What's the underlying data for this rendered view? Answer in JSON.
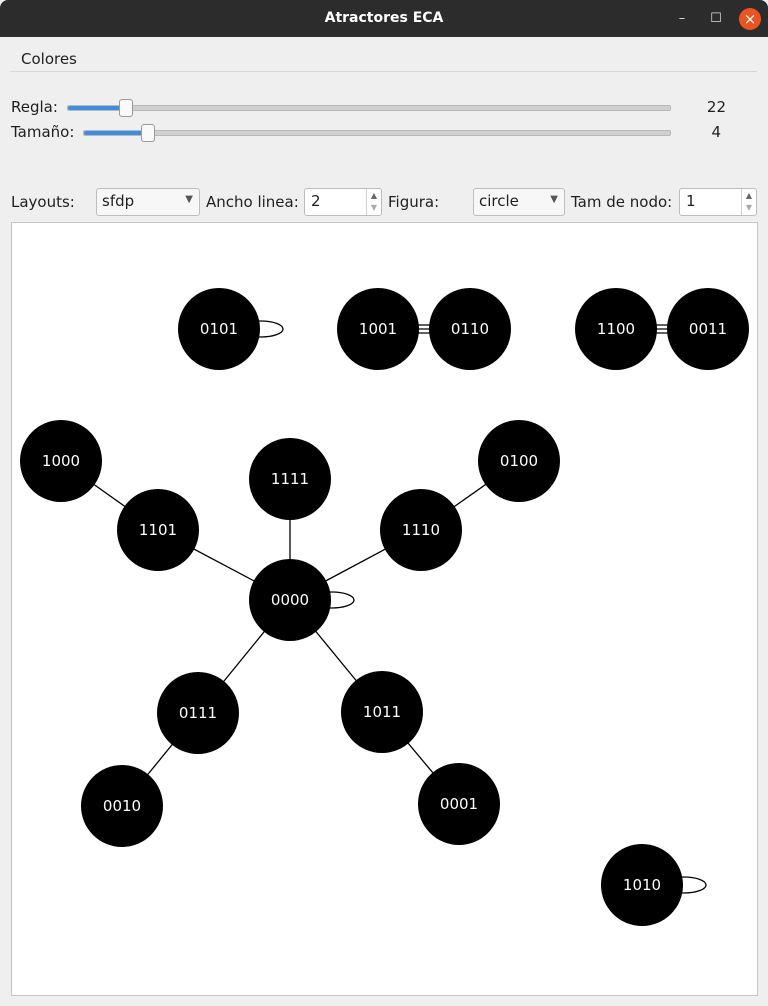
{
  "window": {
    "title": "Atractores ECA"
  },
  "menu": {
    "items": [
      "Colores"
    ]
  },
  "controls": {
    "regla": {
      "label": "Regla:",
      "value": "22",
      "fraction": 0.1
    },
    "tamano": {
      "label": "Tamaño:",
      "value": "4",
      "fraction": 0.11
    },
    "layouts": {
      "label": "Layouts:",
      "value": "sfdp"
    },
    "ancho": {
      "label": "Ancho linea:",
      "value": "2"
    },
    "figura": {
      "label": "Figura:",
      "value": "circle"
    },
    "tam_nodo": {
      "label": "Tam de nodo:",
      "value": "1"
    }
  },
  "graph": {
    "nodes": [
      "0101",
      "1001",
      "0110",
      "1100",
      "0011",
      "1000",
      "1111",
      "0100",
      "1101",
      "1110",
      "0000",
      "0111",
      "1011",
      "0010",
      "0001",
      "1010"
    ],
    "self_loops": [
      "0101",
      "0000",
      "1010"
    ],
    "edges": [
      [
        "1001",
        "0110"
      ],
      [
        "1100",
        "0011"
      ],
      [
        "1000",
        "1101"
      ],
      [
        "1101",
        "0000"
      ],
      [
        "1111",
        "0000"
      ],
      [
        "0100",
        "1110"
      ],
      [
        "1110",
        "0000"
      ],
      [
        "0000",
        "0111"
      ],
      [
        "0000",
        "1011"
      ],
      [
        "0111",
        "0010"
      ],
      [
        "1011",
        "0001"
      ]
    ]
  }
}
